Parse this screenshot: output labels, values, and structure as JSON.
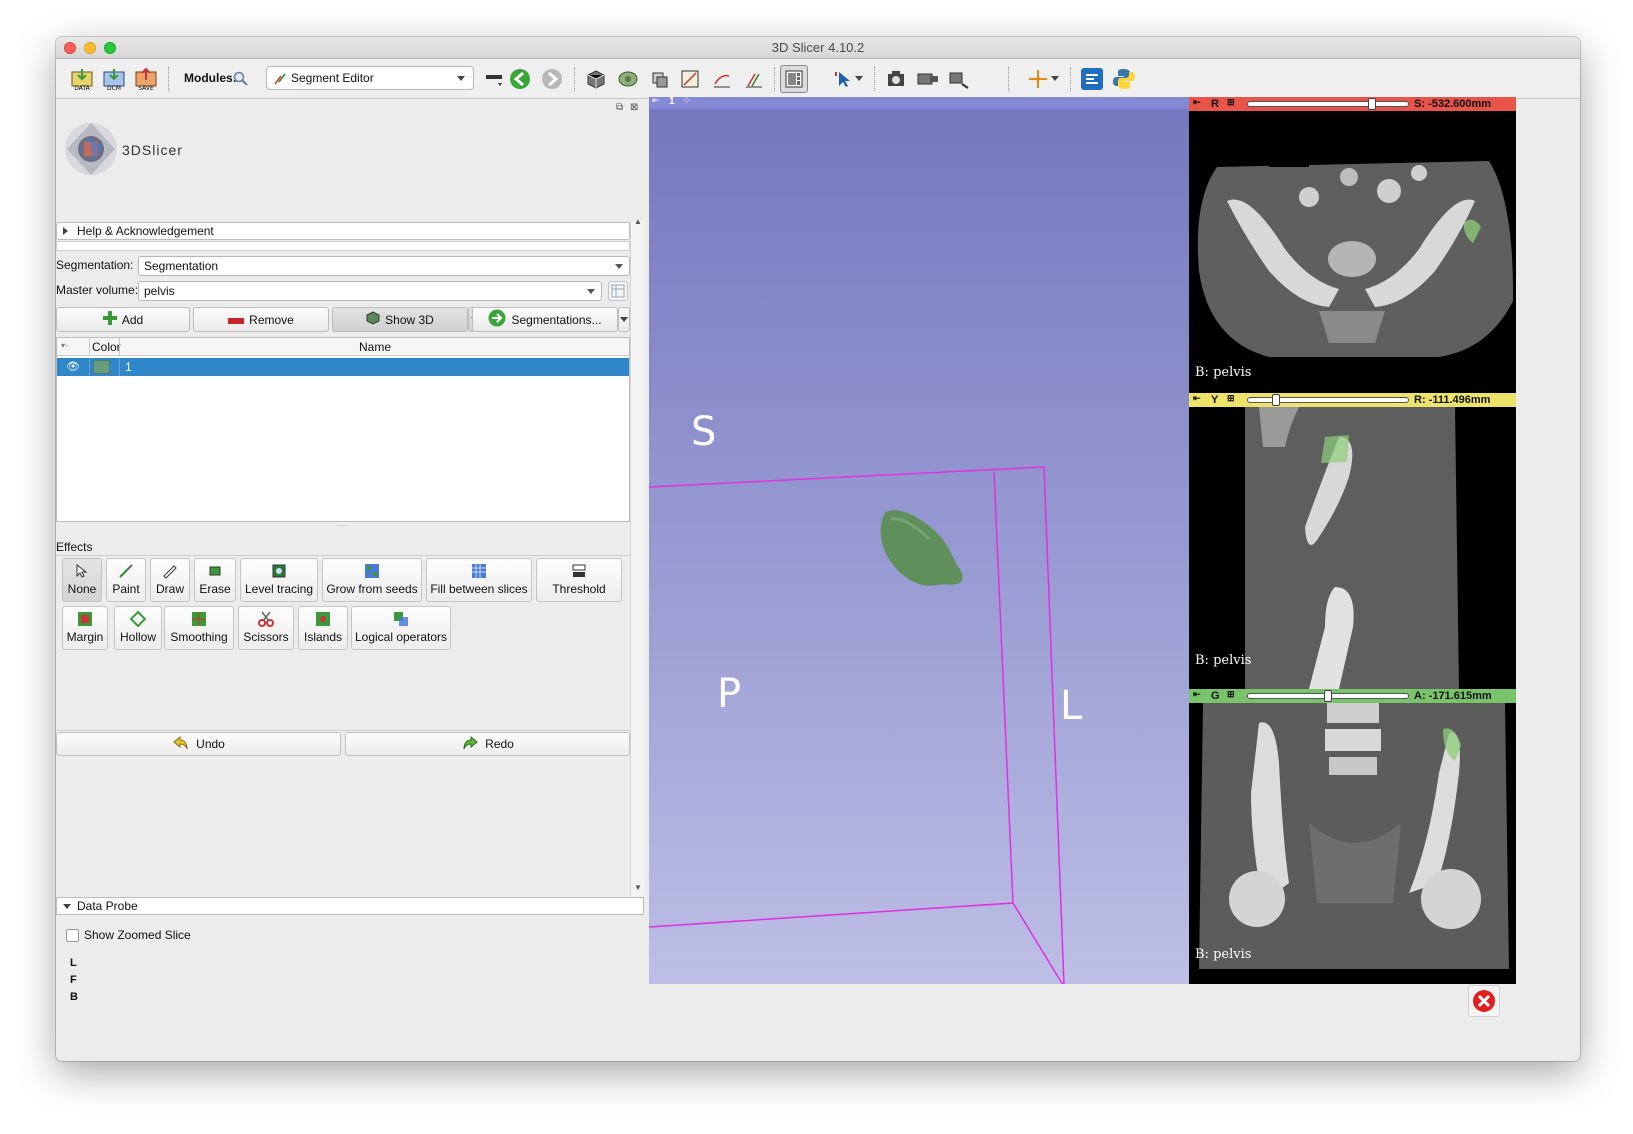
{
  "window": {
    "title": "3D Slicer 4.10.2"
  },
  "toolbar": {
    "modules_label": "Modules:",
    "module_selected": "Segment Editor",
    "icons": [
      "data-icon",
      "dcm-icon",
      "save-icon",
      "search-icon",
      "layout-icon",
      "back-icon",
      "forward-icon",
      "volume-icon",
      "model-icon",
      "slice-icon",
      "markups-icon",
      "segment-icon",
      "editor-icon",
      "layout-compare-icon",
      "crosshair-icon",
      "screenshot-icon",
      "extension-icon",
      "python-icon"
    ],
    "data_label": "DATA",
    "dcm_label": "DCM",
    "save_label": "SAVE"
  },
  "logo": {
    "text": "3DSlicer"
  },
  "help": {
    "label": "Help & Acknowledgement"
  },
  "segmentation": {
    "label": "Segmentation:",
    "value": "Segmentation",
    "master_label": "Master volume:",
    "master_value": "pelvis"
  },
  "actions": {
    "add": "Add",
    "remove": "Remove",
    "show3d": "Show 3D",
    "segmentations": "Segmentations..."
  },
  "table": {
    "col_color": "Color",
    "col_name": "Name",
    "rows": [
      {
        "name": "1",
        "color": "#6a9c82"
      }
    ]
  },
  "effects": {
    "label": "Effects",
    "items": [
      "None",
      "Paint",
      "Draw",
      "Erase",
      "Level tracing",
      "Grow from seeds",
      "Fill between slices",
      "Threshold",
      "Margin",
      "Hollow",
      "Smoothing",
      "Scissors",
      "Islands",
      "Logical operators"
    ]
  },
  "undo": {
    "undo": "Undo",
    "redo": "Redo"
  },
  "data_probe": {
    "label": "Data Probe",
    "show_zoomed": "Show Zoomed Slice",
    "lines": [
      "L",
      "F",
      "B"
    ]
  },
  "view3d": {
    "number": "1",
    "orient_s": "S",
    "orient_p": "P",
    "orient_l": "L",
    "bg_color": "#8a8ecc",
    "segment_color": "#5f8f5a"
  },
  "slices": [
    {
      "letter": "R",
      "value": "S: -532.600mm",
      "bg_label": "B: pelvis",
      "color": "#e8534a",
      "slider_pos": 0.75
    },
    {
      "letter": "Y",
      "value": "R: -111.496mm",
      "bg_label": "B: pelvis",
      "color": "#ede36a",
      "slider_pos": 0.17
    },
    {
      "letter": "G",
      "value": "A: -171.615mm",
      "bg_label": "B: pelvis",
      "color": "#79c46a",
      "slider_pos": 0.48
    }
  ]
}
